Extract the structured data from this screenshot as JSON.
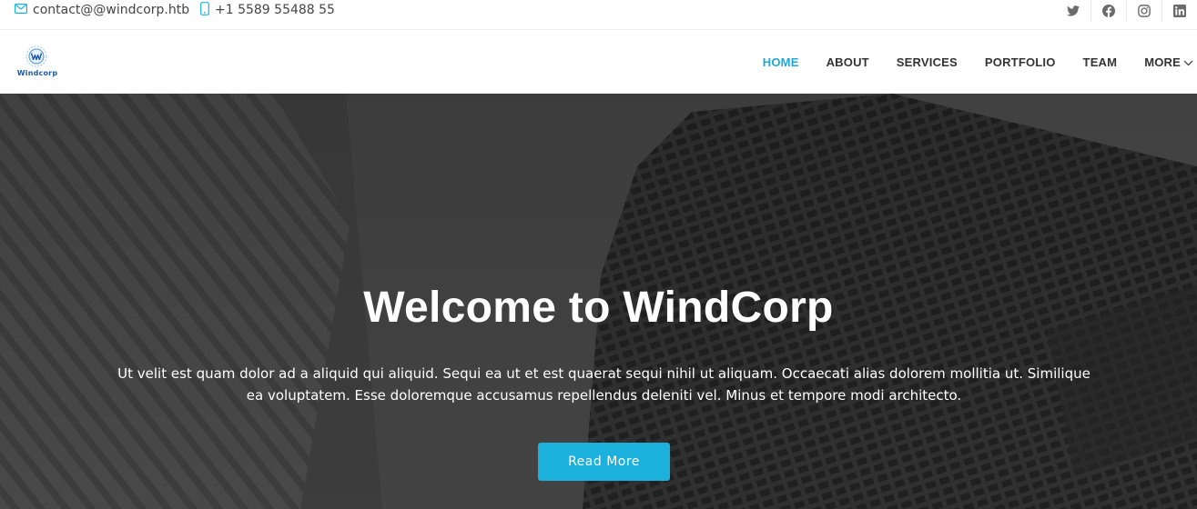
{
  "topbar": {
    "email": "contact@@windcorp.htb",
    "phone": "+1 5589 55488 55",
    "email_icon": "envelope-icon",
    "phone_icon": "phone-icon",
    "socials": [
      "twitter-icon",
      "facebook-icon",
      "instagram-icon",
      "linkedin-icon"
    ]
  },
  "header": {
    "logo_text": "Windcorp",
    "nav": {
      "home": "HOME",
      "about": "ABOUT",
      "services": "SERVICES",
      "portfolio": "PORTFOLIO",
      "team": "TEAM",
      "more": "MORE"
    }
  },
  "hero": {
    "title": "Welcome to WindCorp",
    "text": "Ut velit est quam dolor ad a aliquid qui aliquid. Sequi ea ut et est quaerat sequi nihil ut aliquam. Occaecati alias dolorem mollitia ut. Similique ea voluptatem. Esse doloremque accusamus repellendus deleniti vel. Minus et tempore modi architecto.",
    "button": "Read More"
  },
  "colors": {
    "accent": "#1bb1dc",
    "nav_active": "#1fa9d6",
    "hero_overlay": "#434343"
  }
}
